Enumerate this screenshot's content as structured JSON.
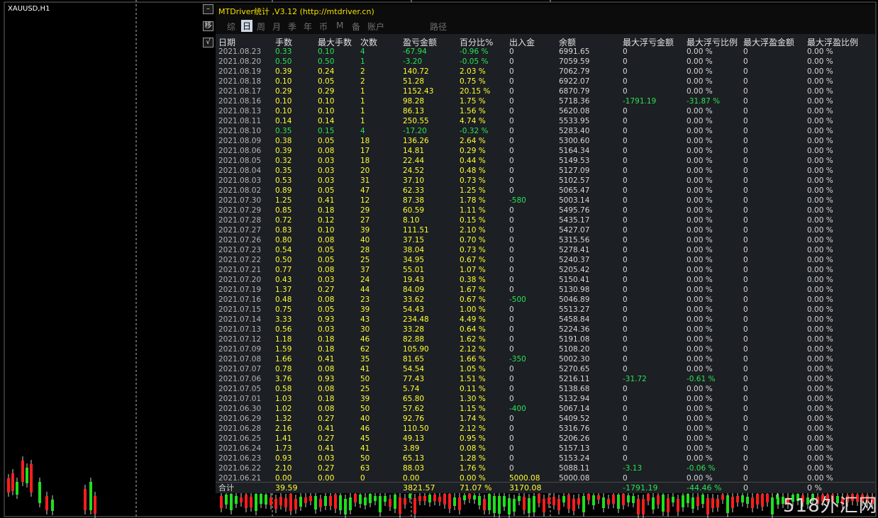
{
  "symbol": "XAUUSD,H1",
  "controls": {
    "minimize": "–",
    "move": "移",
    "check": "√"
  },
  "panel": {
    "title": "MTDriver统计 ,V3.12 (http://mtdriver.cn)",
    "tabs": [
      {
        "label": "综",
        "active": false
      },
      {
        "label": "日",
        "active": true
      },
      {
        "label": "周",
        "active": false
      },
      {
        "label": "月",
        "active": false
      },
      {
        "label": "季",
        "active": false
      },
      {
        "label": "年",
        "active": false
      },
      {
        "label": "币",
        "active": false
      },
      {
        "label": "M",
        "active": false
      },
      {
        "label": "备",
        "active": false
      },
      {
        "label": "账户",
        "active": false
      },
      {
        "label": "路径",
        "active": false
      }
    ],
    "columns": [
      "日期",
      "手数",
      "最大手数",
      "次数",
      "盈亏金额",
      "百分比%",
      "出入金",
      "余额",
      "最大浮亏金额",
      "最大浮亏比例",
      "最大浮盈金额",
      "最大浮盈比例"
    ],
    "rows": [
      [
        "2021.08.23",
        "0.33",
        "0.10",
        "4",
        "-67.94",
        "-0.96 %",
        "0",
        "6991.65",
        "0",
        "0.00 %",
        "0",
        "0.00 %"
      ],
      [
        "2021.08.20",
        "0.50",
        "0.50",
        "1",
        "-3.20",
        "-0.05 %",
        "0",
        "7059.59",
        "0",
        "0.00 %",
        "0",
        "0.00 %"
      ],
      [
        "2021.08.19",
        "0.39",
        "0.24",
        "2",
        "140.72",
        "2.03 %",
        "0",
        "7062.79",
        "0",
        "0.00 %",
        "0",
        "0.00 %"
      ],
      [
        "2021.08.18",
        "0.10",
        "0.05",
        "2",
        "51.28",
        "0.75 %",
        "0",
        "6922.07",
        "0",
        "0.00 %",
        "0",
        "0.00 %"
      ],
      [
        "2021.08.17",
        "0.29",
        "0.29",
        "1",
        "1152.43",
        "20.15 %",
        "0",
        "6870.79",
        "0",
        "0.00 %",
        "0",
        "0.00 %"
      ],
      [
        "2021.08.16",
        "0.10",
        "0.10",
        "1",
        "98.28",
        "1.75 %",
        "0",
        "5718.36",
        "-1791.19",
        "-31.87 %",
        "0",
        "0.00 %"
      ],
      [
        "2021.08.13",
        "0.10",
        "0.10",
        "1",
        "86.13",
        "1.56 %",
        "0",
        "5620.08",
        "0",
        "0.00 %",
        "0",
        "0.00 %"
      ],
      [
        "2021.08.11",
        "0.14",
        "0.14",
        "1",
        "250.55",
        "4.74 %",
        "0",
        "5533.95",
        "0",
        "0.00 %",
        "0",
        "0.00 %"
      ],
      [
        "2021.08.10",
        "0.35",
        "0.15",
        "4",
        "-17.20",
        "-0.32 %",
        "0",
        "5283.40",
        "0",
        "0.00 %",
        "0",
        "0.00 %"
      ],
      [
        "2021.08.09",
        "0.38",
        "0.05",
        "18",
        "136.26",
        "2.64 %",
        "0",
        "5300.60",
        "0",
        "0.00 %",
        "0",
        "0.00 %"
      ],
      [
        "2021.08.06",
        "0.39",
        "0.08",
        "17",
        "14.81",
        "0.29 %",
        "0",
        "5164.34",
        "0",
        "0.00 %",
        "0",
        "0.00 %"
      ],
      [
        "2021.08.05",
        "0.32",
        "0.03",
        "18",
        "22.44",
        "0.44 %",
        "0",
        "5149.53",
        "0",
        "0.00 %",
        "0",
        "0.00 %"
      ],
      [
        "2021.08.04",
        "0.35",
        "0.03",
        "20",
        "24.52",
        "0.48 %",
        "0",
        "5127.09",
        "0",
        "0.00 %",
        "0",
        "0.00 %"
      ],
      [
        "2021.08.03",
        "0.53",
        "0.03",
        "31",
        "37.10",
        "0.73 %",
        "0",
        "5102.57",
        "0",
        "0.00 %",
        "0",
        "0.00 %"
      ],
      [
        "2021.08.02",
        "0.89",
        "0.05",
        "47",
        "62.33",
        "1.25 %",
        "0",
        "5065.47",
        "0",
        "0.00 %",
        "0",
        "0.00 %"
      ],
      [
        "2021.07.30",
        "1.25",
        "0.41",
        "12",
        "87.38",
        "1.78 %",
        "-580",
        "5003.14",
        "0",
        "0.00 %",
        "0",
        "0.00 %"
      ],
      [
        "2021.07.29",
        "0.85",
        "0.18",
        "29",
        "60.59",
        "1.11 %",
        "0",
        "5495.76",
        "0",
        "0.00 %",
        "0",
        "0.00 %"
      ],
      [
        "2021.07.28",
        "0.72",
        "0.12",
        "27",
        "8.10",
        "0.15 %",
        "0",
        "5435.17",
        "0",
        "0.00 %",
        "0",
        "0.00 %"
      ],
      [
        "2021.07.27",
        "0.83",
        "0.10",
        "39",
        "111.51",
        "2.10 %",
        "0",
        "5427.07",
        "0",
        "0.00 %",
        "0",
        "0.00 %"
      ],
      [
        "2021.07.26",
        "0.80",
        "0.08",
        "40",
        "37.15",
        "0.70 %",
        "0",
        "5315.56",
        "0",
        "0.00 %",
        "0",
        "0.00 %"
      ],
      [
        "2021.07.23",
        "0.54",
        "0.05",
        "28",
        "38.04",
        "0.73 %",
        "0",
        "5278.41",
        "0",
        "0.00 %",
        "0",
        "0.00 %"
      ],
      [
        "2021.07.22",
        "0.50",
        "0.05",
        "25",
        "34.95",
        "0.67 %",
        "0",
        "5240.37",
        "0",
        "0.00 %",
        "0",
        "0.00 %"
      ],
      [
        "2021.07.21",
        "0.77",
        "0.08",
        "37",
        "55.01",
        "1.07 %",
        "0",
        "5205.42",
        "0",
        "0.00 %",
        "0",
        "0.00 %"
      ],
      [
        "2021.07.20",
        "0.43",
        "0.03",
        "24",
        "19.43",
        "0.38 %",
        "0",
        "5150.41",
        "0",
        "0.00 %",
        "0",
        "0.00 %"
      ],
      [
        "2021.07.19",
        "1.37",
        "0.27",
        "44",
        "84.09",
        "1.67 %",
        "0",
        "5130.98",
        "0",
        "0.00 %",
        "0",
        "0.00 %"
      ],
      [
        "2021.07.16",
        "0.48",
        "0.08",
        "23",
        "33.62",
        "0.67 %",
        "-500",
        "5046.89",
        "0",
        "0.00 %",
        "0",
        "0.00 %"
      ],
      [
        "2021.07.15",
        "0.75",
        "0.05",
        "39",
        "54.43",
        "1.00 %",
        "0",
        "5513.27",
        "0",
        "0.00 %",
        "0",
        "0.00 %"
      ],
      [
        "2021.07.14",
        "3.33",
        "0.93",
        "43",
        "234.48",
        "4.49 %",
        "0",
        "5458.84",
        "0",
        "0.00 %",
        "0",
        "0.00 %"
      ],
      [
        "2021.07.13",
        "0.56",
        "0.03",
        "30",
        "33.28",
        "0.64 %",
        "0",
        "5224.36",
        "0",
        "0.00 %",
        "0",
        "0.00 %"
      ],
      [
        "2021.07.12",
        "1.18",
        "0.18",
        "46",
        "82.88",
        "1.62 %",
        "0",
        "5191.08",
        "0",
        "0.00 %",
        "0",
        "0.00 %"
      ],
      [
        "2021.07.09",
        "1.59",
        "0.18",
        "62",
        "105.90",
        "2.12 %",
        "0",
        "5108.20",
        "0",
        "0.00 %",
        "0",
        "0.00 %"
      ],
      [
        "2021.07.08",
        "1.66",
        "0.41",
        "35",
        "81.65",
        "1.66 %",
        "-350",
        "5002.30",
        "0",
        "0.00 %",
        "0",
        "0.00 %"
      ],
      [
        "2021.07.07",
        "0.78",
        "0.08",
        "41",
        "54.54",
        "1.05 %",
        "0",
        "5270.65",
        "0",
        "0.00 %",
        "0",
        "0.00 %"
      ],
      [
        "2021.07.06",
        "3.76",
        "0.93",
        "50",
        "77.43",
        "1.51 %",
        "0",
        "5216.11",
        "-31.72",
        "-0.61 %",
        "0",
        "0.00 %"
      ],
      [
        "2021.07.05",
        "0.58",
        "0.08",
        "25",
        "5.74",
        "0.11 %",
        "0",
        "5138.68",
        "0",
        "0.00 %",
        "0",
        "0.00 %"
      ],
      [
        "2021.07.01",
        "1.03",
        "0.18",
        "39",
        "65.80",
        "1.30 %",
        "0",
        "5132.94",
        "0",
        "0.00 %",
        "0",
        "0.00 %"
      ],
      [
        "2021.06.30",
        "1.02",
        "0.08",
        "50",
        "57.62",
        "1.15 %",
        "-400",
        "5067.14",
        "0",
        "0.00 %",
        "0",
        "0.00 %"
      ],
      [
        "2021.06.29",
        "1.32",
        "0.27",
        "40",
        "92.76",
        "1.74 %",
        "0",
        "5409.52",
        "0",
        "0.00 %",
        "0",
        "0.00 %"
      ],
      [
        "2021.06.28",
        "2.16",
        "0.41",
        "46",
        "110.50",
        "2.12 %",
        "0",
        "5316.76",
        "0",
        "0.00 %",
        "0",
        "0.00 %"
      ],
      [
        "2021.06.25",
        "1.41",
        "0.27",
        "45",
        "49.13",
        "0.95 %",
        "0",
        "5206.26",
        "0",
        "0.00 %",
        "0",
        "0.00 %"
      ],
      [
        "2021.06.24",
        "1.73",
        "0.41",
        "41",
        "3.89",
        "0.08 %",
        "0",
        "5157.13",
        "0",
        "0.00 %",
        "0",
        "0.00 %"
      ],
      [
        "2021.06.23",
        "0.93",
        "0.03",
        "50",
        "65.13",
        "1.28 %",
        "0",
        "5153.24",
        "0",
        "0.00 %",
        "0",
        "0.00 %"
      ],
      [
        "2021.06.22",
        "2.10",
        "0.27",
        "63",
        "88.03",
        "1.76 %",
        "0",
        "5088.11",
        "-3.13",
        "-0.06 %",
        "0",
        "0.00 %"
      ],
      [
        "2021.06.21",
        "0.00",
        "0.00",
        "0",
        "0.00",
        "0.00 %",
        "5000.08",
        "5000.08",
        "0",
        "0.00 %",
        "0",
        "0.00 %"
      ]
    ],
    "total": [
      "合计",
      "39.59",
      "",
      "",
      "3821.57",
      "71.07 %",
      "3170.08",
      "",
      "-1791.19",
      "-44.46 %",
      "0",
      "0 %"
    ]
  },
  "colors": {
    "yellow": "#ffff33",
    "green": "#2be255",
    "bull": "#1ee01e",
    "bear": "#ff1e1e"
  },
  "watermark": "518外汇网"
}
